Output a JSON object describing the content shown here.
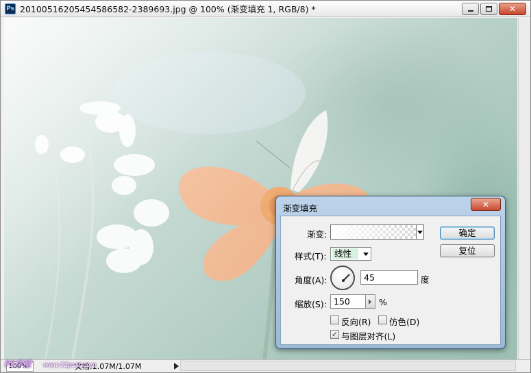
{
  "window": {
    "app_icon": "ps-icon",
    "app_icon_text": "Ps",
    "title": "20100516205454586582-2389693.jpg @ 100% (渐变填充 1, RGB/8) *"
  },
  "status_bar": {
    "zoom": "100%",
    "doc_info": "文档:1.07M/1.07M"
  },
  "watermark": {
    "brand": "PS学堂",
    "site": "www.52psxt.com"
  },
  "dialog": {
    "title": "渐变填充",
    "gradient_label": "渐变:",
    "style_label": "样式(T):",
    "style_value": "线性",
    "angle_label": "角度(A):",
    "angle_value": "45",
    "angle_unit": "度",
    "scale_label": "缩放(S):",
    "scale_value": "150",
    "scale_unit": "%",
    "reverse_label": "反向(R)",
    "reverse_checked": false,
    "dither_label": "仿色(D)",
    "dither_checked": false,
    "align_label": "与图层对齐(L)",
    "align_checked": true,
    "ok_label": "确定",
    "reset_label": "复位"
  },
  "colors": {
    "canvas_base": "#b9cfc6",
    "flower": "#f4a06a",
    "dialog_frame": "#a9c4df"
  }
}
